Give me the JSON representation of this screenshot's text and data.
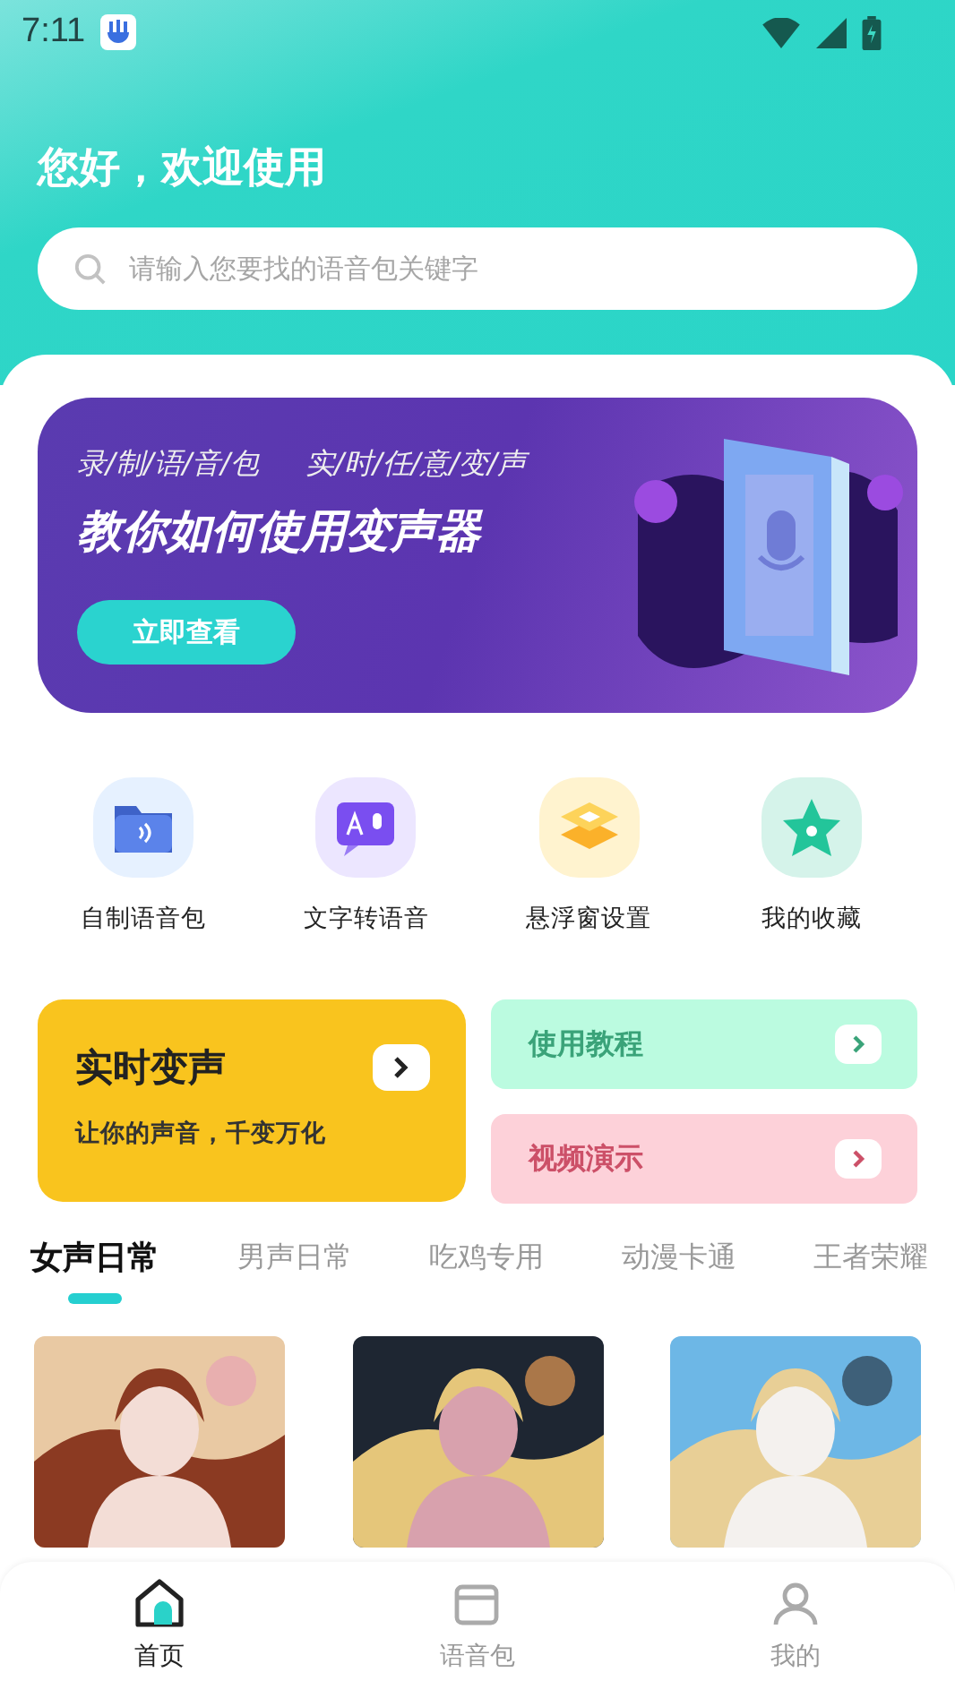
{
  "status_bar": {
    "time": "7:11"
  },
  "greeting": "您好，欢迎使用",
  "search": {
    "placeholder": "请输入您要找的语音包关键字"
  },
  "banner": {
    "subtitle_left": "录/制/语/音/包",
    "subtitle_right": "实/时/任/意/变/声",
    "title": "教你如何使用变声器",
    "button": "立即查看"
  },
  "shortcuts": [
    {
      "label": "自制语音包",
      "kind": "folder"
    },
    {
      "label": "文字转语音",
      "kind": "speech"
    },
    {
      "label": "悬浮窗设置",
      "kind": "layers"
    },
    {
      "label": "我的收藏",
      "kind": "star"
    }
  ],
  "feature_card": {
    "title": "实时变声",
    "subtitle": "让你的声音，千变万化"
  },
  "side_cards": [
    {
      "label": "使用教程",
      "kind": "green"
    },
    {
      "label": "视频演示",
      "kind": "pink"
    }
  ],
  "category_tabs": [
    {
      "label": "女声日常",
      "selected": true
    },
    {
      "label": "男声日常",
      "selected": false
    },
    {
      "label": "吃鸡专用",
      "selected": false
    },
    {
      "label": "动漫卡通",
      "selected": false
    },
    {
      "label": "王者荣耀",
      "selected": false
    }
  ],
  "bottom_nav": [
    {
      "label": "首页",
      "selected": true,
      "kind": "home"
    },
    {
      "label": "语音包",
      "selected": false,
      "kind": "pack"
    },
    {
      "label": "我的",
      "selected": false,
      "kind": "me"
    }
  ]
}
